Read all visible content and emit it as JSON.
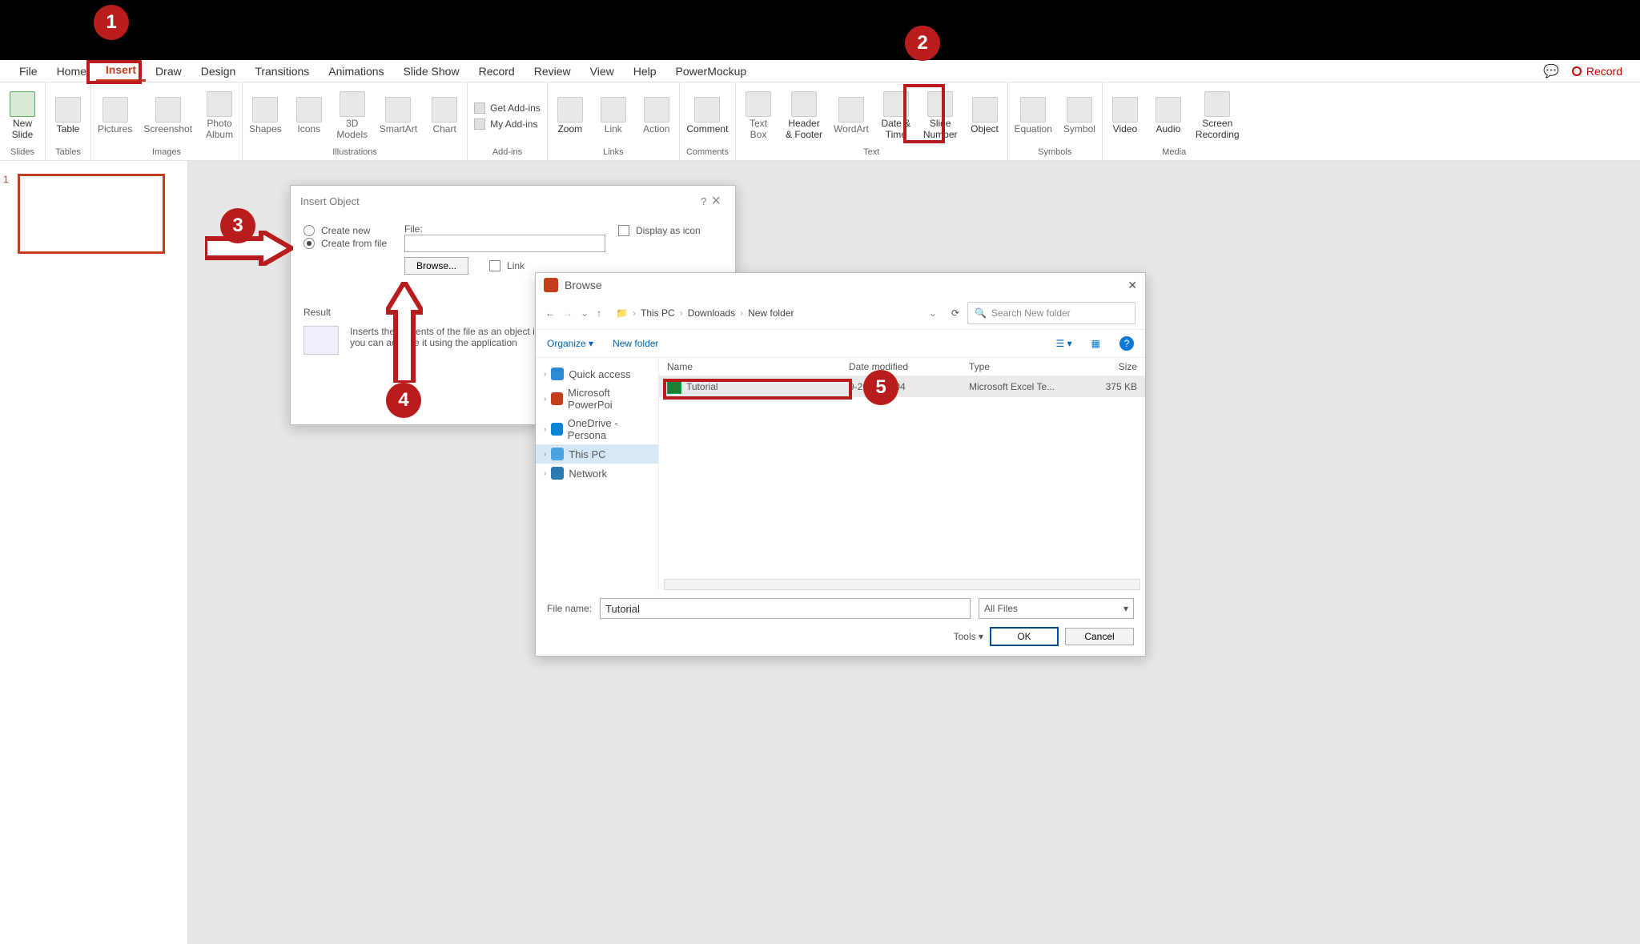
{
  "menubar": {
    "tabs": [
      "File",
      "Home",
      "Insert",
      "Draw",
      "Design",
      "Transitions",
      "Animations",
      "Slide Show",
      "Record",
      "Review",
      "View",
      "Help",
      "PowerMockup"
    ],
    "active_index": 2
  },
  "top_right": {
    "record": "Record"
  },
  "ribbon": {
    "groups": [
      {
        "label": "Slides",
        "items": [
          {
            "name": "new-slide",
            "label": "New\nSlide"
          }
        ]
      },
      {
        "label": "Tables",
        "items": [
          {
            "name": "table",
            "label": "Table"
          }
        ]
      },
      {
        "label": "Images",
        "items": [
          {
            "name": "pictures",
            "label": "Pictures"
          },
          {
            "name": "screenshot",
            "label": "Screenshot"
          },
          {
            "name": "photo-album",
            "label": "Photo\nAlbum"
          }
        ]
      },
      {
        "label": "Illustrations",
        "items": [
          {
            "name": "shapes",
            "label": "Shapes"
          },
          {
            "name": "icons",
            "label": "Icons"
          },
          {
            "name": "3d-models",
            "label": "3D\nModels"
          },
          {
            "name": "smartart",
            "label": "SmartArt"
          },
          {
            "name": "chart",
            "label": "Chart"
          }
        ]
      },
      {
        "label": "Add-ins",
        "addins": {
          "get": "Get Add-ins",
          "my": "My Add-ins"
        }
      },
      {
        "label": "Links",
        "items": [
          {
            "name": "zoom",
            "label": "Zoom"
          },
          {
            "name": "link",
            "label": "Link"
          },
          {
            "name": "action",
            "label": "Action"
          }
        ]
      },
      {
        "label": "Comments",
        "items": [
          {
            "name": "comment",
            "label": "Comment"
          }
        ]
      },
      {
        "label": "Text",
        "items": [
          {
            "name": "text-box",
            "label": "Text\nBox"
          },
          {
            "name": "header-footer",
            "label": "Header\n& Footer"
          },
          {
            "name": "wordart",
            "label": "WordArt"
          },
          {
            "name": "date-time",
            "label": "Date &\nTime"
          },
          {
            "name": "slide-number",
            "label": "Slide\nNumber"
          },
          {
            "name": "object",
            "label": "Object"
          }
        ]
      },
      {
        "label": "Symbols",
        "items": [
          {
            "name": "equation",
            "label": "Equation"
          },
          {
            "name": "symbol",
            "label": "Symbol"
          }
        ]
      },
      {
        "label": "Media",
        "items": [
          {
            "name": "video",
            "label": "Video"
          },
          {
            "name": "audio",
            "label": "Audio"
          },
          {
            "name": "screen-recording",
            "label": "Screen\nRecording"
          }
        ]
      }
    ]
  },
  "thumb": {
    "num": "1"
  },
  "insert_dlg": {
    "title": "Insert Object",
    "create_new": "Create new",
    "create_from_file": "Create from file",
    "file_label": "File:",
    "browse": "Browse...",
    "link": "Link",
    "display_icon": "Display as icon",
    "result": "Result",
    "result_text": "Inserts the contents of the file as an object in… that you can activate it using the application",
    "help": "?",
    "close": "×"
  },
  "browse_dlg": {
    "title": "Browse",
    "path": [
      "This PC",
      "Downloads",
      "New folder"
    ],
    "search_placeholder": "Search New folder",
    "organize": "Organize",
    "new_folder": "New folder",
    "nav": [
      {
        "name": "quick-access",
        "label": "Quick access"
      },
      {
        "name": "microsoft-powerpoint",
        "label": "Microsoft PowerPoi"
      },
      {
        "name": "onedrive-personal",
        "label": "OneDrive - Persona"
      },
      {
        "name": "this-pc",
        "label": "This PC"
      },
      {
        "name": "network",
        "label": "Network"
      }
    ],
    "cols": {
      "name": "Name",
      "date": "Date modified",
      "type": "Type",
      "size": "Size"
    },
    "file": {
      "name": "Tutorial",
      "date": "9-2022 10:04",
      "type": "Microsoft Excel Te...",
      "size": "375 KB"
    },
    "file_name_label": "File name:",
    "file_name_value": "Tutorial",
    "filter": "All Files",
    "tools": "Tools",
    "ok": "OK",
    "cancel": "Cancel",
    "close": "✕"
  },
  "markers": {
    "m1": "1",
    "m2": "2",
    "m3": "3",
    "m4": "4",
    "m5": "5"
  }
}
